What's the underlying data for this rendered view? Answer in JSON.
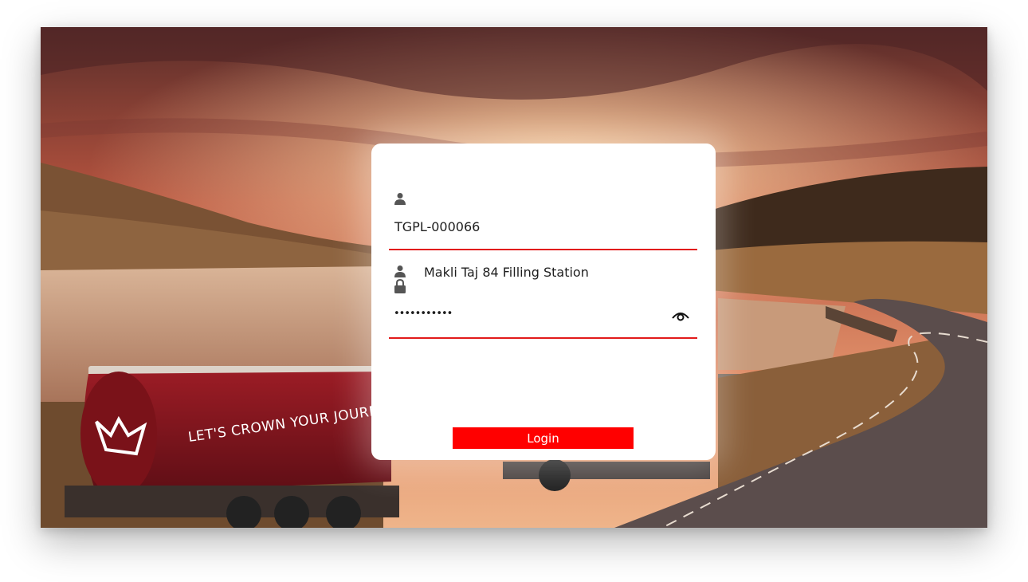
{
  "background": {
    "tanker_slogan": "LET'S CROWN YOUR JOURNEY"
  },
  "login": {
    "username_icon": "user-icon",
    "username_value": "TGPL-000066",
    "station_icon": "user-icon",
    "station_name": "Makli Taj 84 Filling Station",
    "password_icon": "lock-icon",
    "password_value": "•••••••••••",
    "visibility_icon": "eye-icon",
    "login_label": "Login"
  },
  "colors": {
    "accent": "#e21b1b",
    "button": "#ff0000"
  }
}
